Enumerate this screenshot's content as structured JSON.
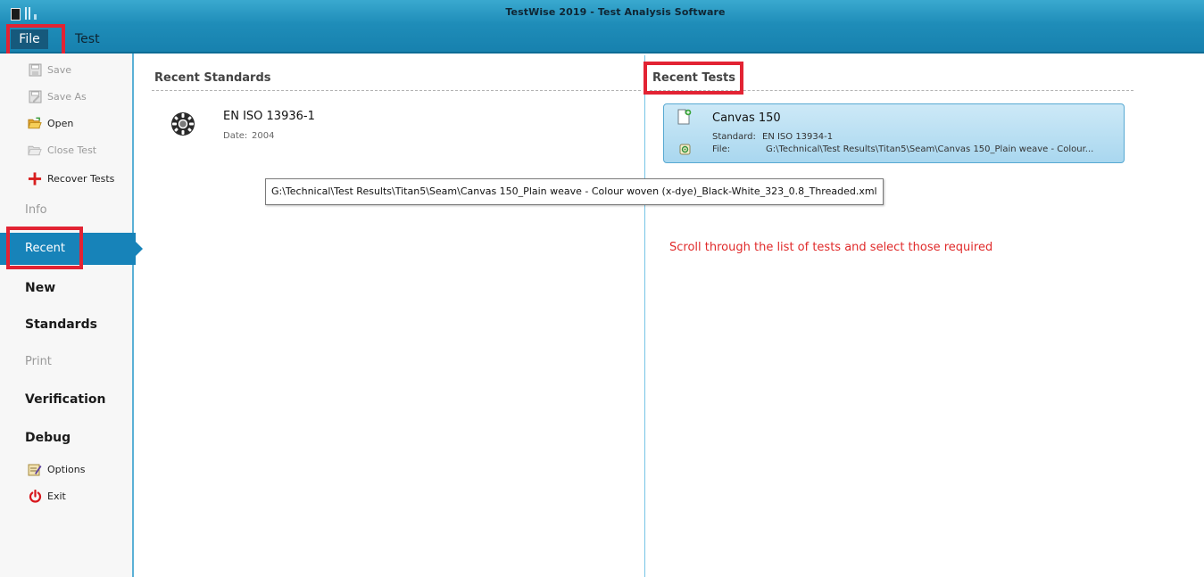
{
  "window": {
    "title": "TestWise 2019 - Test Analysis Software"
  },
  "ribbon": {
    "tabs": [
      {
        "label": "File",
        "selected": true
      },
      {
        "label": "Test",
        "selected": false
      }
    ]
  },
  "sidebar": {
    "commands": [
      {
        "label": "Save",
        "icon": "save-icon",
        "enabled": false
      },
      {
        "label": "Save As",
        "icon": "save-as-icon",
        "enabled": false
      },
      {
        "label": "Open",
        "icon": "open-folder-icon",
        "enabled": true
      },
      {
        "label": "Close Test",
        "icon": "close-test-icon",
        "enabled": false
      },
      {
        "label": "Recover Tests",
        "icon": "plus-icon",
        "enabled": true
      }
    ],
    "sections": [
      {
        "label": "Info",
        "enabled": false,
        "selected": false
      },
      {
        "label": "Recent",
        "enabled": true,
        "selected": true
      },
      {
        "label": "New",
        "enabled": true,
        "selected": false
      },
      {
        "label": "Standards",
        "enabled": true,
        "selected": false
      },
      {
        "label": "Print",
        "enabled": false,
        "selected": false
      },
      {
        "label": "Verification",
        "enabled": true,
        "selected": false
      },
      {
        "label": "Debug",
        "enabled": true,
        "selected": false
      }
    ],
    "footer": [
      {
        "label": "Options",
        "icon": "options-icon"
      },
      {
        "label": "Exit",
        "icon": "power-icon"
      }
    ]
  },
  "recent_standards": {
    "heading": "Recent Standards",
    "items": [
      {
        "name": "EN ISO 13936-1",
        "date_label": "Date:",
        "date": "2004",
        "icon": "gear-icon"
      }
    ]
  },
  "recent_tests": {
    "heading": "Recent Tests",
    "items": [
      {
        "name": "Canvas 150",
        "standard_label": "Standard:",
        "standard": "EN ISO 13934-1",
        "file_label": "File:",
        "file": "G:\\Technical\\Test Results\\Titan5\\Seam\\Canvas 150_Plain weave - Colour..."
      }
    ]
  },
  "tooltip": {
    "text": "G:\\Technical\\Test Results\\Titan5\\Seam\\Canvas 150_Plain weave - Colour woven (x-dye)_Black-White_323_0.8_Threaded.xml"
  },
  "annotation": {
    "text": "Scroll through the list of tests and select those required",
    "color": "#e02a2a"
  },
  "colors": {
    "accent": "#1783b9",
    "highlight": "#e22333"
  }
}
